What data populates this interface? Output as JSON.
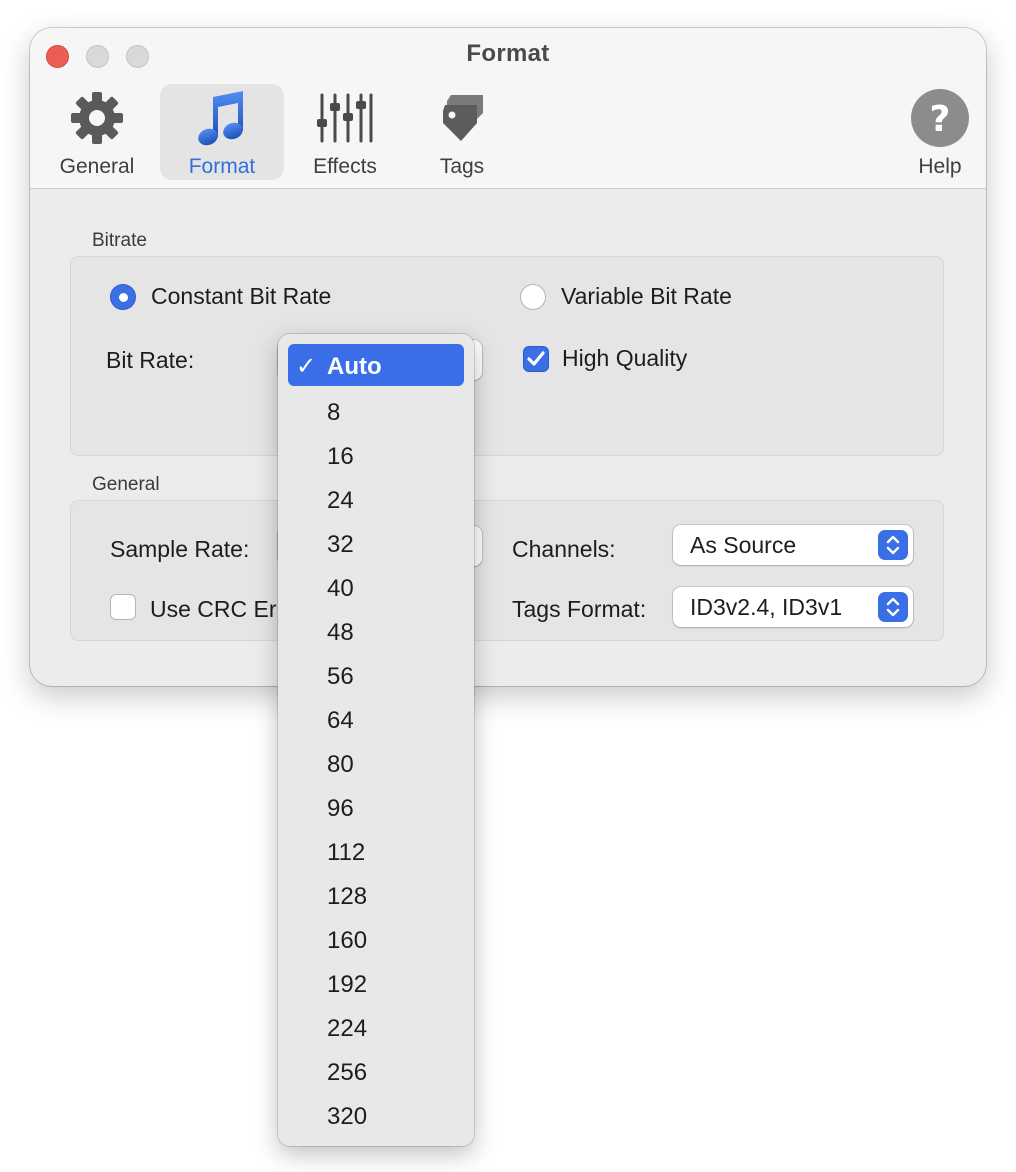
{
  "window": {
    "title": "Format"
  },
  "toolbar": {
    "tabs": [
      {
        "label": "General",
        "icon": "gear-icon"
      },
      {
        "label": "Format",
        "icon": "music-note-icon",
        "active": true
      },
      {
        "label": "Effects",
        "icon": "sliders-icon"
      },
      {
        "label": "Tags",
        "icon": "tag-icon"
      }
    ],
    "help_label": "Help"
  },
  "bitrate_group": {
    "label": "Bitrate",
    "constant_label": "Constant Bit Rate",
    "constant_selected": true,
    "variable_label": "Variable Bit Rate",
    "variable_selected": false,
    "bit_rate_label": "Bit Rate:",
    "high_quality_label": "High Quality",
    "high_quality_checked": true
  },
  "general_group": {
    "label": "General",
    "sample_rate_label": "Sample Rate:",
    "crc_label": "Use CRC Er",
    "crc_checked": false,
    "channels_label": "Channels:",
    "channels_value": "As Source",
    "tags_format_label": "Tags Format:",
    "tags_format_value": "ID3v2.4, ID3v1"
  },
  "bitrate_menu": {
    "selected": "Auto",
    "checkmark": "✓",
    "options": [
      "Auto",
      "8",
      "16",
      "24",
      "32",
      "40",
      "48",
      "56",
      "64",
      "80",
      "96",
      "112",
      "128",
      "160",
      "192",
      "224",
      "256",
      "320"
    ]
  },
  "colors": {
    "accent": "#3b6fe6",
    "close": "#ed5d55"
  }
}
